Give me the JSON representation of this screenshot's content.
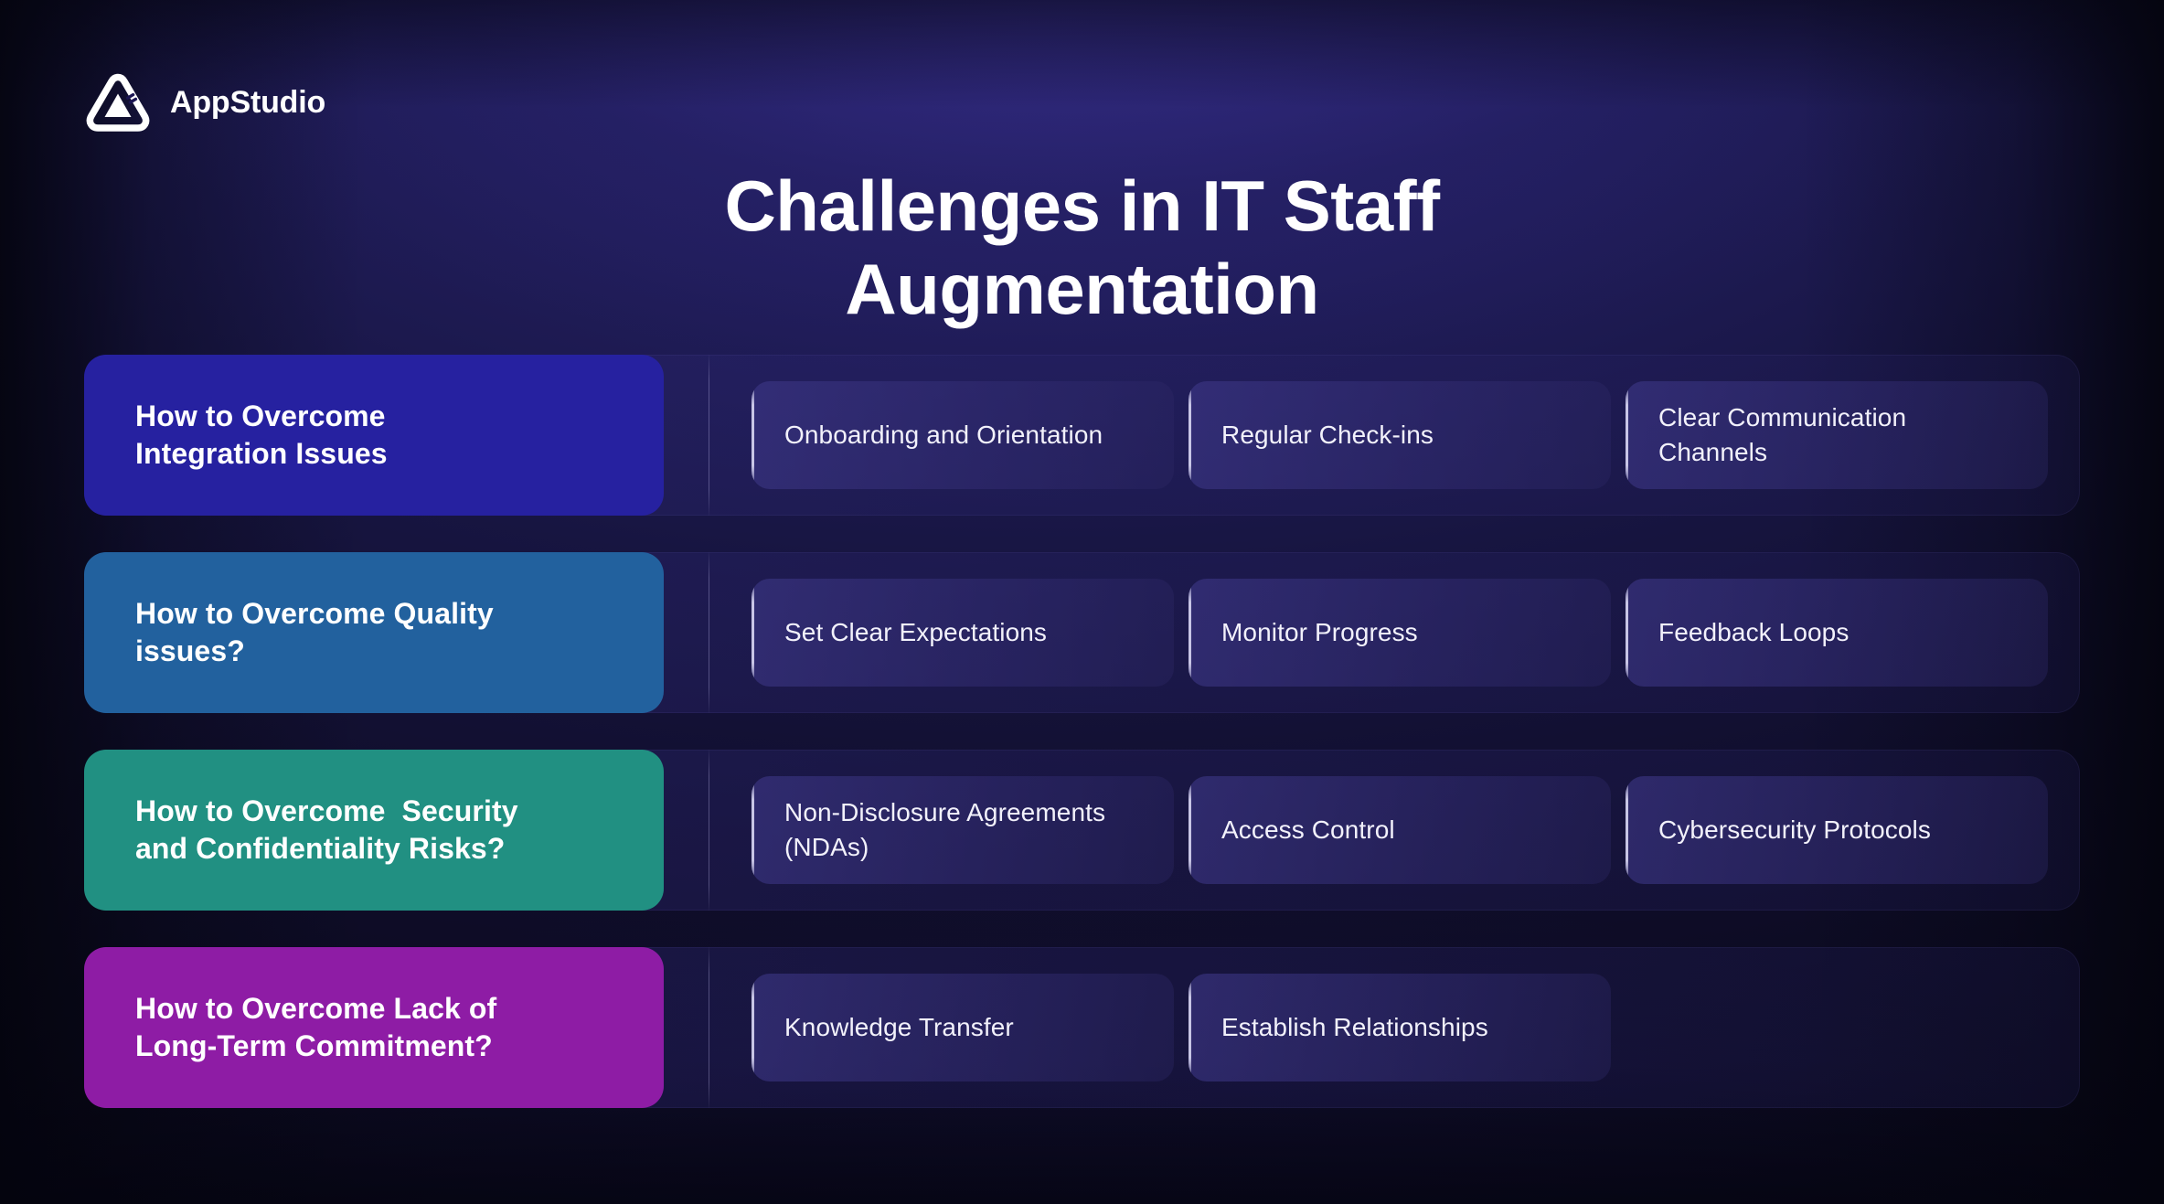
{
  "brand": {
    "name": "AppStudio",
    "logo_icon": "appstudio-triangle-logo"
  },
  "title": "Challenges in IT Staff\nAugmentation",
  "colors": {
    "background_deep": "#07061a",
    "background_mid": "#171541",
    "background_top": "#2a2470",
    "row_1_accent": "#2621a0",
    "row_2_accent": "#22619e",
    "row_3_accent": "#219082",
    "row_4_accent": "#8e1ca5",
    "chip_fill": "#3d3787",
    "text_primary": "#ffffff",
    "chip_edge_highlight": "#e2e0fa"
  },
  "rows": [
    {
      "label": "How to Overcome\nIntegration Issues",
      "color": "#2621a0",
      "items": [
        {
          "label": "Onboarding and Orientation"
        },
        {
          "label": "Regular Check-ins"
        },
        {
          "label": "Clear Communication Channels"
        }
      ]
    },
    {
      "label": "How to Overcome Quality\nissues?",
      "color": "#22619e",
      "items": [
        {
          "label": "Set Clear Expectations"
        },
        {
          "label": "Monitor Progress"
        },
        {
          "label": "Feedback Loops"
        }
      ]
    },
    {
      "label": "How to Overcome  Security\nand Confidentiality Risks?",
      "color": "#219082",
      "items": [
        {
          "label": "Non-Disclosure Agreements (NDAs)"
        },
        {
          "label": "Access Control"
        },
        {
          "label": "Cybersecurity Protocols"
        }
      ]
    },
    {
      "label": "How to Overcome Lack of\nLong-Term Commitment?",
      "color": "#8e1ca5",
      "items": [
        {
          "label": "Knowledge Transfer"
        },
        {
          "label": "Establish Relationships"
        }
      ]
    }
  ]
}
